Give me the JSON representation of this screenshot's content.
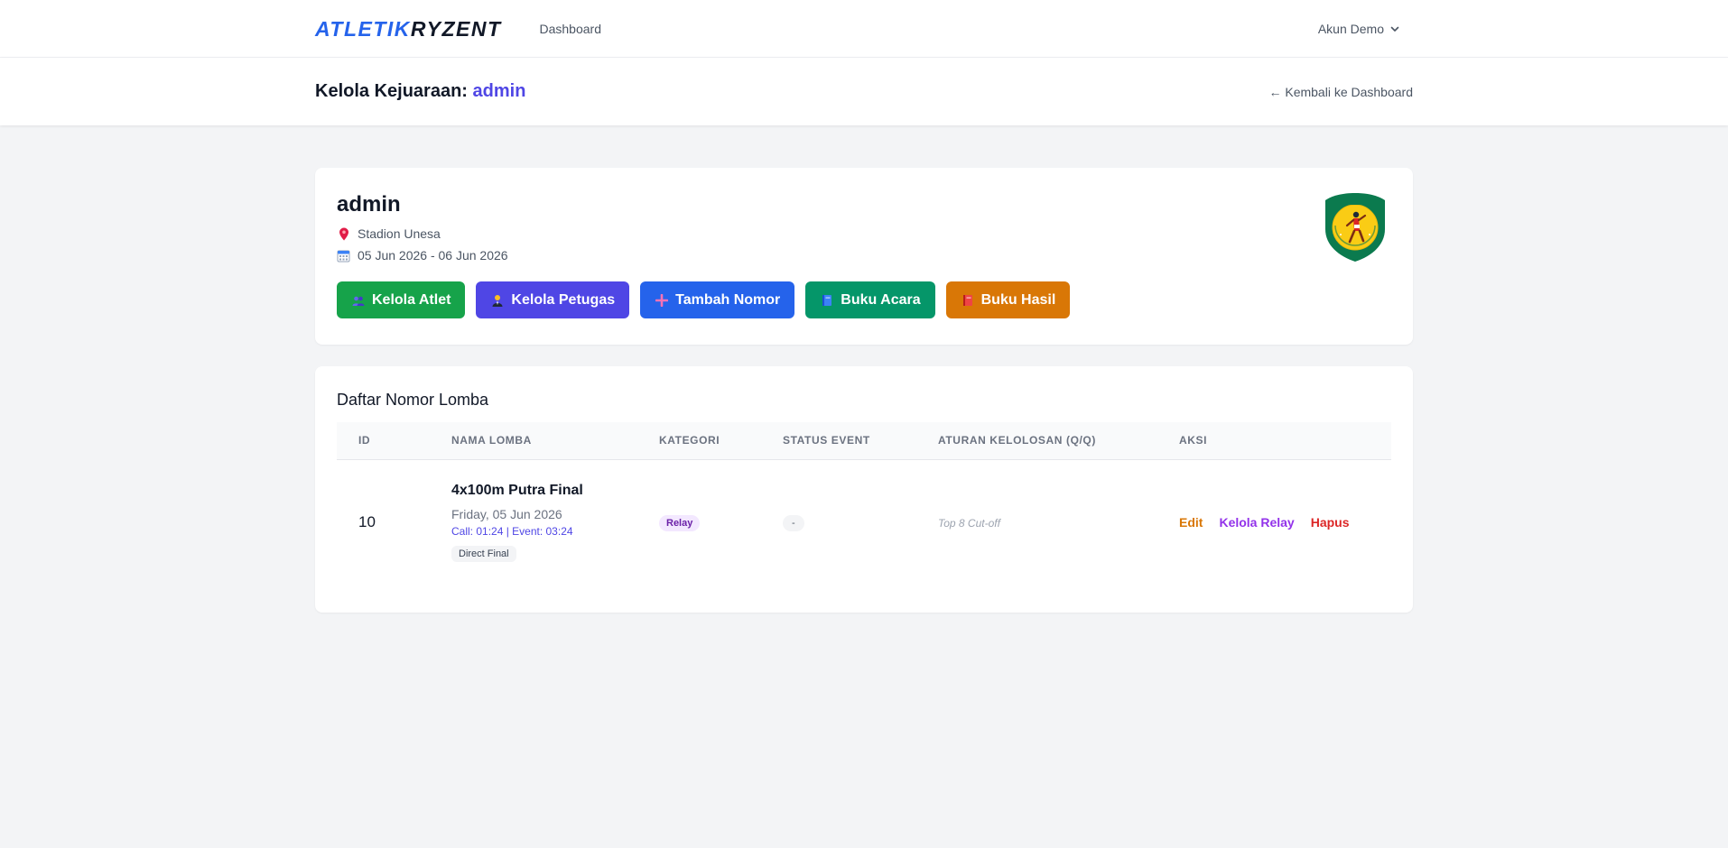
{
  "nav": {
    "brand_part1": "ATLETIK",
    "brand_part2": "RYZENT",
    "dashboard_link": "Dashboard",
    "user_label": "Akun Demo"
  },
  "header": {
    "title_prefix": "Kelola Kejuaraan:",
    "title_name": "admin",
    "back_link": "← Kembali ke Dashboard"
  },
  "event": {
    "name": "admin",
    "venue": "Stadion Unesa",
    "dates": "05 Jun 2026 - 06 Jun 2026",
    "buttons": {
      "athletes": "Kelola Atlet",
      "officials": "Kelola Petugas",
      "add_event": "Tambah Nomor",
      "program_book": "Buku Acara",
      "results_book": "Buku Hasil"
    }
  },
  "races": {
    "title": "Daftar Nomor Lomba",
    "columns": [
      "ID",
      "NAMA LOMBA",
      "KATEGORI",
      "STATUS EVENT",
      "ATURAN KELOLOSAN (Q/Q)",
      "AKSI"
    ],
    "rows": [
      {
        "id": "10",
        "name": "4x100m Putra Final",
        "date": "Friday, 05 Jun 2026",
        "times": "Call: 01:24 | Event: 03:24",
        "round": "Direct Final",
        "category": "Relay",
        "status": "-",
        "rule": "Top 8 Cut-off",
        "actions": {
          "edit": "Edit",
          "relay": "Kelola Relay",
          "delete": "Hapus"
        }
      }
    ]
  }
}
